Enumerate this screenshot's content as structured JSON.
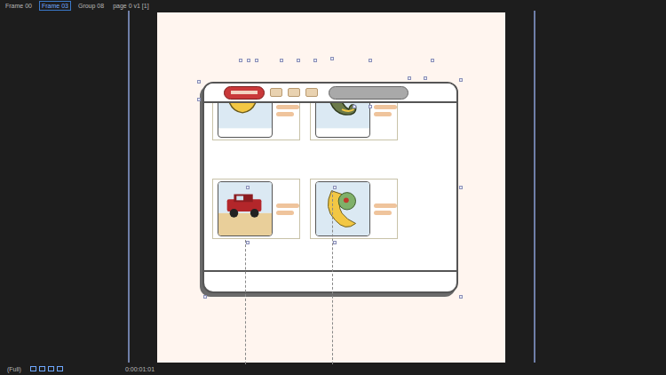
{
  "breadcrumbs": [
    {
      "label": "Frame 00",
      "selected": false
    },
    {
      "label": "Frame 03",
      "selected": true
    },
    {
      "label": "Group 08",
      "selected": false
    },
    {
      "label": "page 0 v1 [1]",
      "selected": false
    }
  ],
  "viewer": {
    "resolution": "(Full)",
    "timecode": "0:00:01:01"
  },
  "cards": [
    {
      "kind": "blob"
    },
    {
      "kind": "worm"
    },
    {
      "kind": "car"
    },
    {
      "kind": "creature"
    }
  ]
}
